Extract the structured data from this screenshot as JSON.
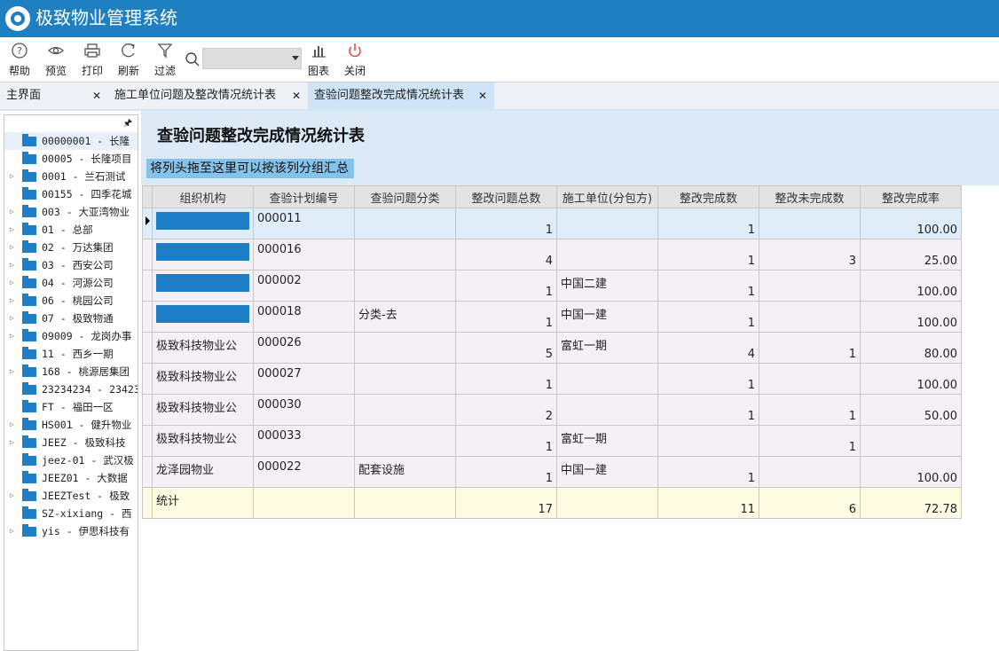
{
  "app": {
    "title": "极致物业管理系统"
  },
  "toolbar": {
    "help": "帮助",
    "preview": "预览",
    "print": "打印",
    "refresh": "刷新",
    "filter": "过滤",
    "chart": "图表",
    "close": "关闭",
    "search_value": ""
  },
  "tabs": [
    {
      "label": "主界面"
    },
    {
      "label": "施工单位问题及整改情况统计表"
    },
    {
      "label": "查验问题整改完成情况统计表"
    }
  ],
  "sidebar": {
    "pin": "ᵖ",
    "items": [
      {
        "label": "00000001 - 长隆"
      },
      {
        "label": "00005 - 长隆项目"
      },
      {
        "label": "0001 - 兰石测试"
      },
      {
        "label": "00155 - 四季花城"
      },
      {
        "label": "003 - 大亚湾物业"
      },
      {
        "label": "01 - 总部"
      },
      {
        "label": "02 - 万达集团"
      },
      {
        "label": "03 - 西安公司"
      },
      {
        "label": "04 - 河源公司"
      },
      {
        "label": "06 - 桃园公司"
      },
      {
        "label": "07 - 极致物通"
      },
      {
        "label": "09009 - 龙岗办事"
      },
      {
        "label": "11 - 西乡一期"
      },
      {
        "label": "168 - 桃源居集团"
      },
      {
        "label": "23234234 - 23423"
      },
      {
        "label": "FT - 福田一区"
      },
      {
        "label": "HS001 - 健升物业"
      },
      {
        "label": "JEEZ - 极致科技"
      },
      {
        "label": "jeez-01 - 武汉极"
      },
      {
        "label": "JEEZ01 - 大数据"
      },
      {
        "label": "JEEZTest - 极致"
      },
      {
        "label": "SZ-xixiang - 西"
      },
      {
        "label": "yis - 伊思科技有"
      }
    ]
  },
  "report": {
    "title": "查验问题整改完成情况统计表",
    "group_hint": "将列头拖至这里可以按该列分组汇总",
    "columns": [
      "组织机构",
      "查验计划编号",
      "查验问题分类",
      "整改问题总数",
      "施工单位(分包方)",
      "整改完成数",
      "整改未完成数",
      "整改完成率"
    ],
    "rows": [
      {
        "org": "",
        "plan": "000011",
        "category": "",
        "total": "1",
        "contractor": "",
        "done": "1",
        "undone": "",
        "rate": "100.00"
      },
      {
        "org": "",
        "plan": "000016",
        "category": "",
        "total": "4",
        "contractor": "",
        "done": "1",
        "undone": "3",
        "rate": "25.00"
      },
      {
        "org": "",
        "plan": "000002",
        "category": "",
        "total": "1",
        "contractor": "中国二建",
        "done": "1",
        "undone": "",
        "rate": "100.00"
      },
      {
        "org": "",
        "plan": "000018",
        "category": "分类-去",
        "total": "1",
        "contractor": "中国一建",
        "done": "1",
        "undone": "",
        "rate": "100.00"
      },
      {
        "org": "极致科技物业公",
        "plan": "000026",
        "category": "",
        "total": "5",
        "contractor": "富虹一期",
        "done": "4",
        "undone": "1",
        "rate": "80.00"
      },
      {
        "org": "极致科技物业公",
        "plan": "000027",
        "category": "",
        "total": "1",
        "contractor": "",
        "done": "1",
        "undone": "",
        "rate": "100.00"
      },
      {
        "org": "极致科技物业公",
        "plan": "000030",
        "category": "",
        "total": "2",
        "contractor": "",
        "done": "1",
        "undone": "1",
        "rate": "50.00"
      },
      {
        "org": "极致科技物业公",
        "plan": "000033",
        "category": "",
        "total": "1",
        "contractor": "富虹一期",
        "done": "",
        "undone": "1",
        "rate": ""
      },
      {
        "org": "龙泽园物业",
        "plan": "000022",
        "category": "配套设施",
        "total": "1",
        "contractor": "中国一建",
        "done": "1",
        "undone": "",
        "rate": "100.00"
      }
    ],
    "summary": {
      "label": "统计",
      "total": "17",
      "done": "11",
      "undone": "6",
      "rate": "72.78"
    }
  },
  "colors": {
    "titlebar": "#1e7fc1",
    "accent": "#1f7fc6",
    "group_hint_bg": "#86c3ea"
  }
}
